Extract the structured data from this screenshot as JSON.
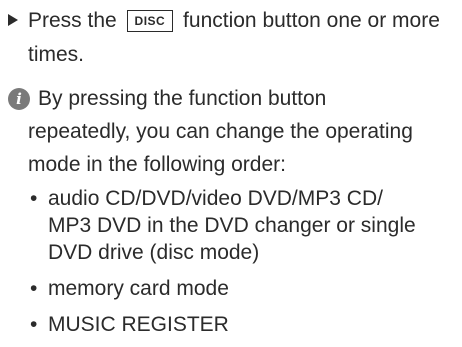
{
  "step": {
    "before": "Press the",
    "key_label": "DISC",
    "after": "function button one or more",
    "continuation": "times."
  },
  "info": {
    "icon": "info-icon",
    "line1": "By pressing the function button",
    "line2": "repeatedly, you can change the operating",
    "line3": "mode in the following order:"
  },
  "bullets": [
    {
      "line1": "audio CD/DVD/video DVD/MP3 CD/",
      "line2": "MP3 DVD in the DVD changer or single",
      "line3": "DVD drive (disc mode)"
    },
    {
      "line1": "memory card mode"
    },
    {
      "line1": "MUSIC REGISTER"
    }
  ]
}
